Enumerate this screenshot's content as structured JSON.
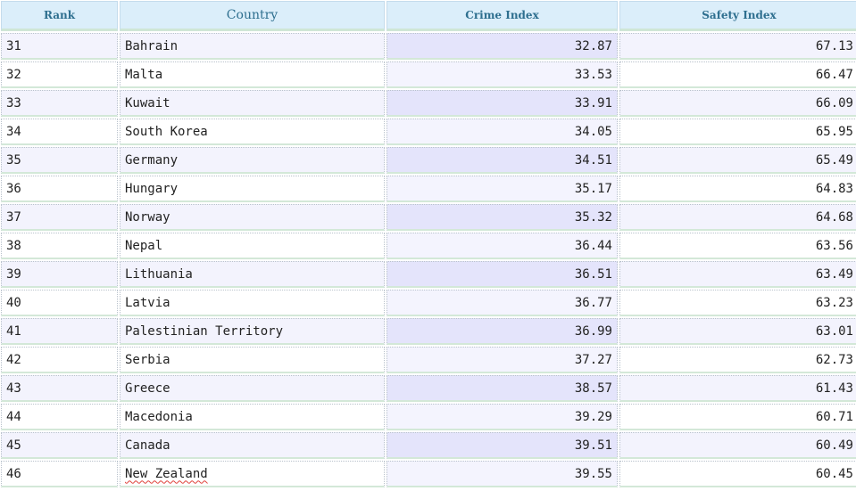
{
  "table": {
    "headers": {
      "rank": "Rank",
      "country": "Country",
      "crime": "Crime Index",
      "safety": "Safety Index"
    },
    "rows": [
      {
        "rank": "31",
        "country": "Bahrain",
        "crime": "32.87",
        "safety": "67.13"
      },
      {
        "rank": "32",
        "country": "Malta",
        "crime": "33.53",
        "safety": "66.47"
      },
      {
        "rank": "33",
        "country": "Kuwait",
        "crime": "33.91",
        "safety": "66.09"
      },
      {
        "rank": "34",
        "country": "South Korea",
        "crime": "34.05",
        "safety": "65.95"
      },
      {
        "rank": "35",
        "country": "Germany",
        "crime": "34.51",
        "safety": "65.49"
      },
      {
        "rank": "36",
        "country": "Hungary",
        "crime": "35.17",
        "safety": "64.83"
      },
      {
        "rank": "37",
        "country": "Norway",
        "crime": "35.32",
        "safety": "64.68"
      },
      {
        "rank": "38",
        "country": "Nepal",
        "crime": "36.44",
        "safety": "63.56"
      },
      {
        "rank": "39",
        "country": "Lithuania",
        "crime": "36.51",
        "safety": "63.49"
      },
      {
        "rank": "40",
        "country": "Latvia",
        "crime": "36.77",
        "safety": "63.23"
      },
      {
        "rank": "41",
        "country": "Palestinian Territory",
        "crime": "36.99",
        "safety": "63.01"
      },
      {
        "rank": "42",
        "country": "Serbia",
        "crime": "37.27",
        "safety": "62.73"
      },
      {
        "rank": "43",
        "country": "Greece",
        "crime": "38.57",
        "safety": "61.43"
      },
      {
        "rank": "44",
        "country": "Macedonia",
        "crime": "39.29",
        "safety": "60.71"
      },
      {
        "rank": "45",
        "country": "Canada",
        "crime": "39.51",
        "safety": "60.49"
      },
      {
        "rank": "46",
        "country": "New Zealand",
        "crime": "39.55",
        "safety": "60.45"
      }
    ]
  }
}
